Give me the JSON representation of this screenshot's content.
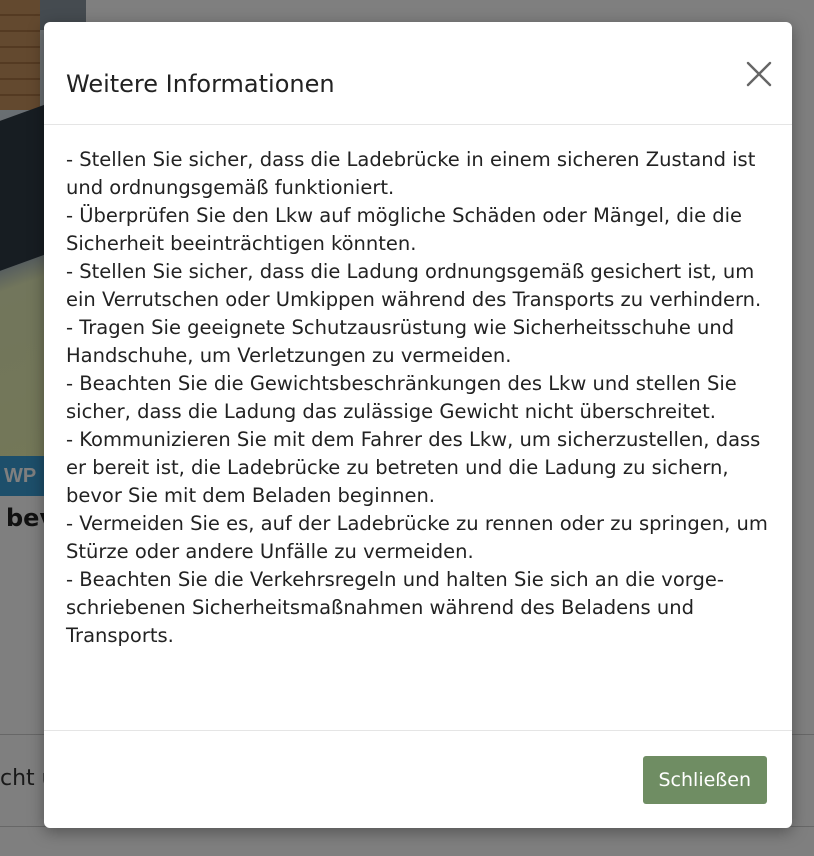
{
  "background": {
    "logo_text": "WP",
    "title_fragment": "bev",
    "footer_fragment": "cht u"
  },
  "modal": {
    "title": "Weitere Informationen",
    "close_icon": "close-icon",
    "body_lines": [
      "- Stellen Sie sicher, dass die Ladebrücke in einem sicheren Zustand ist und ordnungsgemäß funktioniert.",
      "- Überprüfen Sie den Lkw auf mögliche Schäden oder Mängel, die die Sicherheit beeinträchtigen könnten.",
      "- Stellen Sie sicher, dass die Ladung ordnungsgemäß gesichert ist, um ein Verrutschen oder Umkippen während des Transports zu verhindern.",
      "- Tragen Sie geeignete Schutzausrüstung wie Sicherheitsschuhe und Handschuhe, um Verletzungen zu vermeiden.",
      "- Beachten Sie die Gewichtsbeschränkungen des Lkw und stellen Sie sicher, dass die Ladung das zulässige Gewicht nicht überschrei­tet.",
      "- Kommunizieren Sie mit dem Fahrer des Lkw, um sicherzustellen, dass er bereit ist, die Ladebrücke zu betreten und die Ladung zu si­chern, bevor Sie mit dem Beladen beginnen.",
      "- Vermeiden Sie es, auf der Ladebrücke zu rennen oder zu sprin­gen, um Stürze oder andere Unfälle zu vermeiden.",
      "- Beachten Sie die Verkehrsregeln und halten Sie sich an die vorge­schriebenen Sicherheitsmaßnahmen während des Beladens und Transports."
    ],
    "footer_button_label": "Schließen",
    "footer_button_color": "#6f8d63"
  }
}
